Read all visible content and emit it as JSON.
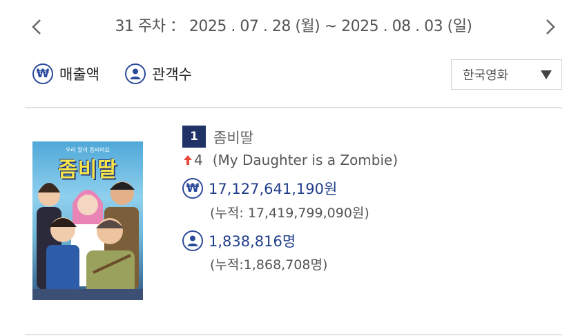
{
  "week": {
    "label": "31 주차 ： 2025 . 07 . 28 (월) ~ 2025 . 08 . 03 (일)",
    "prev_icon": "chevron-left-icon",
    "next_icon": "chevron-right-icon"
  },
  "filters": {
    "revenue_label": "매출액",
    "audience_label": "관객수",
    "nationality_select": "한국영화"
  },
  "colors": {
    "accent": "#2b4a9b",
    "badge": "#1f3366",
    "value": "#1f3d8a",
    "up": "#e8473c"
  },
  "movies": [
    {
      "rank": "1",
      "title_ko": "좀비딸",
      "rank_change": "4",
      "rank_change_direction": "up",
      "title_en": "(My Daughter is a Zombie)",
      "revenue": "17,127,641,190원",
      "cumulative_revenue": "(누적: 17,419,799,090원)",
      "audience": "1,838,816명",
      "cumulative_audience": "(누적:1,868,708명)",
      "poster": {
        "tag": "우리 딸이 좀비여요",
        "title": "좀비딸"
      }
    }
  ]
}
